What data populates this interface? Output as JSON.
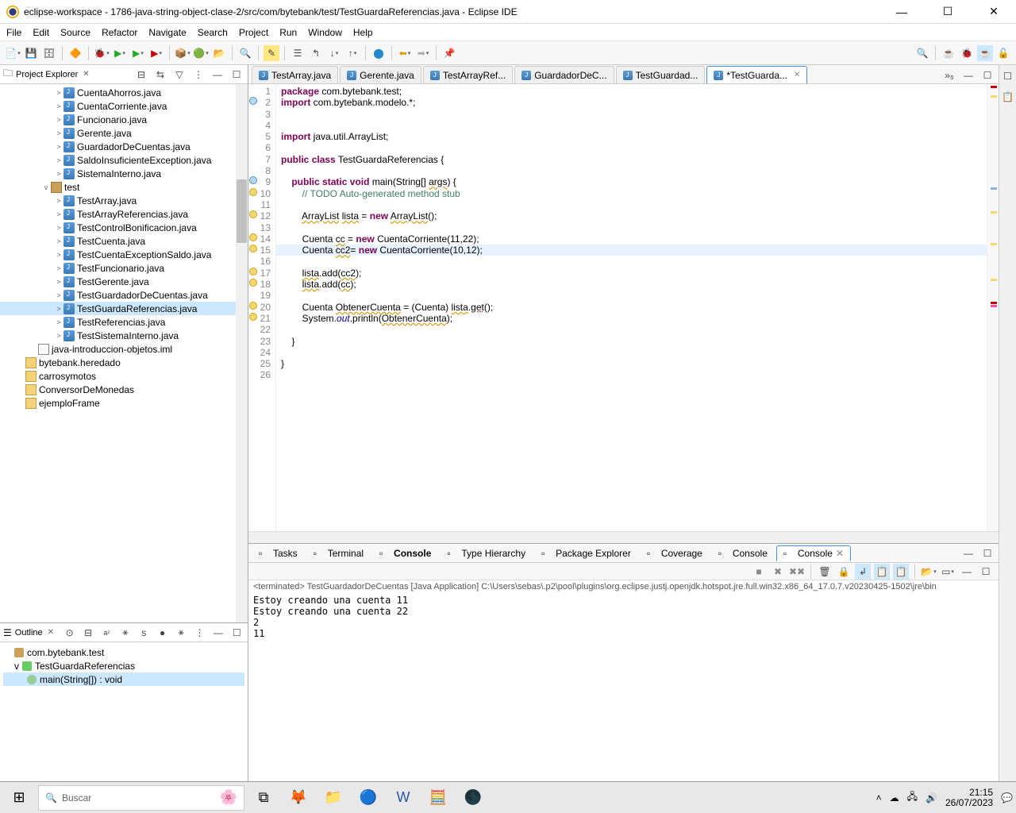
{
  "titlebar": {
    "text": "eclipse-workspace - 1786-java-string-object-clase-2/src/com/bytebank/test/TestGuardaReferencias.java - Eclipse IDE"
  },
  "menu": [
    "File",
    "Edit",
    "Source",
    "Refactor",
    "Navigate",
    "Search",
    "Project",
    "Run",
    "Window",
    "Help"
  ],
  "projectExplorer": {
    "title": "Project Explorer",
    "items": [
      {
        "indent": 4,
        "twist": ">",
        "icon": "java",
        "label": "CuentaAhorros.java"
      },
      {
        "indent": 4,
        "twist": ">",
        "icon": "java",
        "label": "CuentaCorriente.java"
      },
      {
        "indent": 4,
        "twist": ">",
        "icon": "java",
        "label": "Funcionario.java"
      },
      {
        "indent": 4,
        "twist": ">",
        "icon": "java",
        "label": "Gerente.java"
      },
      {
        "indent": 4,
        "twist": ">",
        "icon": "java",
        "label": "GuardadorDeCuentas.java"
      },
      {
        "indent": 4,
        "twist": ">",
        "icon": "java",
        "label": "SaldoInsuficienteException.java"
      },
      {
        "indent": 4,
        "twist": ">",
        "icon": "java",
        "label": "SistemaInterno.java"
      },
      {
        "indent": 3,
        "twist": "v",
        "icon": "pkg",
        "label": "test"
      },
      {
        "indent": 4,
        "twist": ">",
        "icon": "java",
        "label": "TestArray.java"
      },
      {
        "indent": 4,
        "twist": ">",
        "icon": "java",
        "label": "TestArrayReferencias.java"
      },
      {
        "indent": 4,
        "twist": ">",
        "icon": "java",
        "label": "TestControlBonificacion.java"
      },
      {
        "indent": 4,
        "twist": ">",
        "icon": "java",
        "label": "TestCuenta.java"
      },
      {
        "indent": 4,
        "twist": ">",
        "icon": "java",
        "label": "TestCuentaExceptionSaldo.java"
      },
      {
        "indent": 4,
        "twist": ">",
        "icon": "java",
        "label": "TestFuncionario.java"
      },
      {
        "indent": 4,
        "twist": ">",
        "icon": "java",
        "label": "TestGerente.java"
      },
      {
        "indent": 4,
        "twist": ">",
        "icon": "java",
        "label": "TestGuardadorDeCuentas.java"
      },
      {
        "indent": 4,
        "twist": ">",
        "icon": "java",
        "label": "TestGuardaReferencias.java",
        "sel": true
      },
      {
        "indent": 4,
        "twist": ">",
        "icon": "java",
        "label": "TestReferencias.java"
      },
      {
        "indent": 4,
        "twist": ">",
        "icon": "java",
        "label": "TestSistemaInterno.java"
      },
      {
        "indent": 2,
        "twist": "",
        "icon": "file",
        "label": "java-introduccion-objetos.iml"
      },
      {
        "indent": 1,
        "twist": "",
        "icon": "fold",
        "label": "bytebank.heredado"
      },
      {
        "indent": 1,
        "twist": "",
        "icon": "fold",
        "label": "carrosymotos"
      },
      {
        "indent": 1,
        "twist": "",
        "icon": "fold",
        "label": "ConversorDeMonedas"
      },
      {
        "indent": 1,
        "twist": "",
        "icon": "fold",
        "label": "ejemploFrame"
      }
    ]
  },
  "outline": {
    "title": "Outline",
    "items": [
      {
        "indent": 0,
        "icon": "pkg",
        "label": "com.bytebank.test"
      },
      {
        "indent": 0,
        "twist": "v",
        "icon": "class",
        "label": "TestGuardaReferencias"
      },
      {
        "indent": 1,
        "icon": "method",
        "label": "main(String[]) : void",
        "sel": true
      }
    ]
  },
  "tabs": [
    {
      "label": "TestArray.java"
    },
    {
      "label": "Gerente.java"
    },
    {
      "label": "TestArrayRef..."
    },
    {
      "label": "GuardadorDeC..."
    },
    {
      "label": "TestGuardad..."
    },
    {
      "label": "*TestGuarda...",
      "active": true,
      "close": true
    }
  ],
  "code": {
    "lines": [
      {
        "n": 1,
        "html": "<span class='kw'>package</span> com.bytebank.test;"
      },
      {
        "n": 2,
        "html": "<span class='kw'>import</span> com.bytebank.modelo.*;"
      },
      {
        "n": 3,
        "html": ""
      },
      {
        "n": 4,
        "html": ""
      },
      {
        "n": 5,
        "html": "<span class='kw'>import</span> java.util.ArrayList;"
      },
      {
        "n": 6,
        "html": ""
      },
      {
        "n": 7,
        "html": "<span class='kw'>public</span> <span class='kw'>class</span> TestGuardaReferencias {"
      },
      {
        "n": 8,
        "html": ""
      },
      {
        "n": 9,
        "html": "    <span class='kw'>public</span> <span class='kw'>static</span> <span class='kw'>void</span> main(String[] <span class='warn-u'>args</span>) {"
      },
      {
        "n": 10,
        "html": "        <span class='cm'>// TODO Auto-generated method stub</span>"
      },
      {
        "n": 11,
        "html": ""
      },
      {
        "n": 12,
        "html": "        <span class='warn-u'>ArrayList</span> <span class='warn-u'>lista</span> = <span class='kw'>new</span> <span class='warn-u'>ArrayList</span>();"
      },
      {
        "n": 13,
        "html": ""
      },
      {
        "n": 14,
        "html": "        Cuenta <span class='warn-u'>cc</span> = <span class='kw'>new</span> CuentaCorriente(11,22);"
      },
      {
        "n": 15,
        "html": "        Cuenta <span class='warn-u'>cc2</span>= <span class='kw'>new</span> CuentaCorriente(10,12);",
        "hl": true
      },
      {
        "n": 16,
        "html": ""
      },
      {
        "n": 17,
        "html": "        <span class='warn-u'>lista</span>.add(<span class='warn-u'>cc2</span>);"
      },
      {
        "n": 18,
        "html": "        <span class='warn-u'>lista</span>.add(<span class='warn-u'>cc</span>);"
      },
      {
        "n": 19,
        "html": ""
      },
      {
        "n": 20,
        "html": "        Cuenta <span class='warn-u'>ObtenerCuenta</span> = (Cuenta) <span class='warn-u'>lista</span>.<span class='err-u'>get</span>();"
      },
      {
        "n": 21,
        "html": "        System.<span class='fld'>out</span>.println(<span class='warn-u'>ObtenerCuenta</span>);"
      },
      {
        "n": 22,
        "html": ""
      },
      {
        "n": 23,
        "html": "    }"
      },
      {
        "n": 24,
        "html": ""
      },
      {
        "n": 25,
        "html": "}"
      },
      {
        "n": 26,
        "html": ""
      }
    ]
  },
  "bottomTabs": [
    {
      "label": "Tasks"
    },
    {
      "label": "Terminal"
    },
    {
      "label": "Console",
      "bold": true
    },
    {
      "label": "Type Hierarchy"
    },
    {
      "label": "Package Explorer"
    },
    {
      "label": "Coverage"
    },
    {
      "label": "Console"
    },
    {
      "label": "Console",
      "active": true,
      "close": true
    }
  ],
  "console": {
    "info": "<terminated> TestGuardadorDeCuentas [Java Application] C:\\Users\\sebas\\.p2\\pool\\plugins\\org.eclipse.justj.openjdk.hotspot.jre.full.win32.x86_64_17.0.7.v20230425-1502\\jre\\bin",
    "out": "Estoy creando una cuenta 11\nEstoy creando una cuenta 22\n2\n11"
  },
  "taskbar": {
    "search": "Buscar",
    "time": "21:15",
    "date": "26/07/2023"
  }
}
